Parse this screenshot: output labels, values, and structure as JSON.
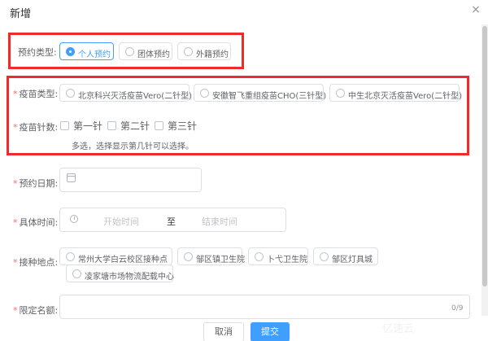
{
  "dialog": {
    "title": "新增",
    "close_symbol": "×"
  },
  "appointment_type": {
    "label": "预约类型:",
    "options": [
      "个人预约",
      "团体预约",
      "外籍预约"
    ],
    "selected": "个人预约"
  },
  "vaccine_type": {
    "required_mark": "*",
    "label": "疫苗类型:",
    "options": [
      "北京科兴灭活疫苗Vero(二针型)",
      "安徽智飞重组疫苗CHO(三针型)",
      "中生北京灭活疫苗Vero(二针型)"
    ]
  },
  "dose_count": {
    "required_mark": "*",
    "label": "疫苗针数:",
    "options": [
      "第一针",
      "第二针",
      "第三针"
    ],
    "hint": "多选，选择显示第几针可以选择。"
  },
  "appointment_date": {
    "required_mark": "*",
    "label": "预约日期:"
  },
  "time_range": {
    "required_mark": "*",
    "label": "具体时间:",
    "start_placeholder": "开始时间",
    "separator": "至",
    "end_placeholder": "结束时间"
  },
  "location": {
    "required_mark": "*",
    "label": "接种地点:",
    "options": [
      "常州大学白云校区接种点",
      "邹区镇卫生院",
      "卜弋卫生院",
      "邹区灯具城",
      "凌家塘市场物流配载中心"
    ]
  },
  "quota": {
    "required_mark": "*",
    "label": "限定名额:",
    "counter": "0/9"
  },
  "footer": {
    "cancel_label": "取消",
    "submit_label": "提交"
  },
  "watermark": "亿速云",
  "colors": {
    "primary": "#409eff",
    "highlight_border": "#ee2b2b",
    "required": "#f56c6c"
  }
}
